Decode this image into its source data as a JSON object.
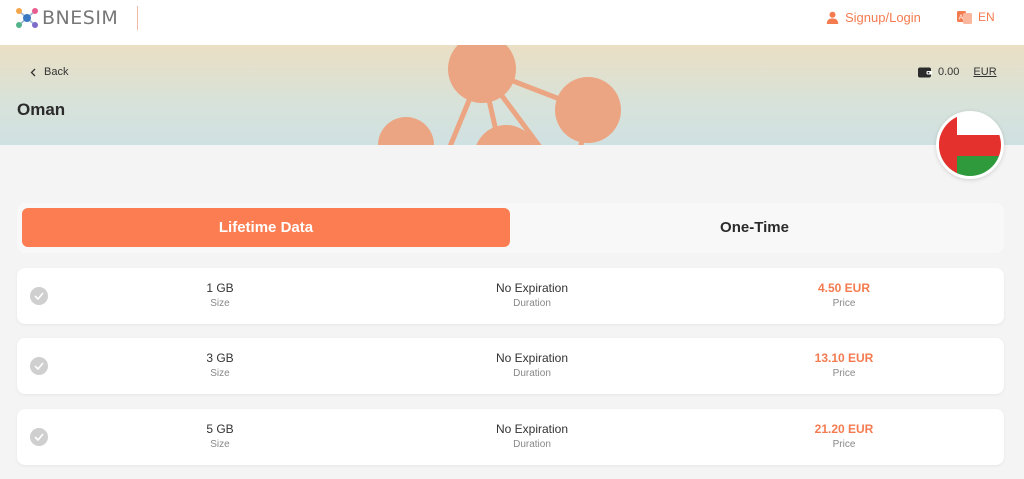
{
  "header": {
    "brand": "BNESIM",
    "signup_label": "Signup/Login",
    "language": "EN"
  },
  "hero": {
    "back_label": "Back",
    "country": "Oman",
    "wallet_balance": "0.00",
    "currency": "EUR"
  },
  "tabs": [
    {
      "label": "Lifetime Data",
      "active": true
    },
    {
      "label": "One-Time",
      "active": false
    }
  ],
  "plans": [
    {
      "size": "1 GB",
      "size_label": "Size",
      "duration": "No Expiration",
      "duration_label": "Duration",
      "price": "4.50 EUR",
      "price_label": "Price"
    },
    {
      "size": "3 GB",
      "size_label": "Size",
      "duration": "No Expiration",
      "duration_label": "Duration",
      "price": "13.10 EUR",
      "price_label": "Price"
    },
    {
      "size": "5 GB",
      "size_label": "Size",
      "duration": "No Expiration",
      "duration_label": "Duration",
      "price": "21.20 EUR",
      "price_label": "Price"
    }
  ],
  "colors": {
    "accent": "#fc7d51",
    "flag_red": "#e5312d",
    "flag_green": "#2e9a3c"
  }
}
